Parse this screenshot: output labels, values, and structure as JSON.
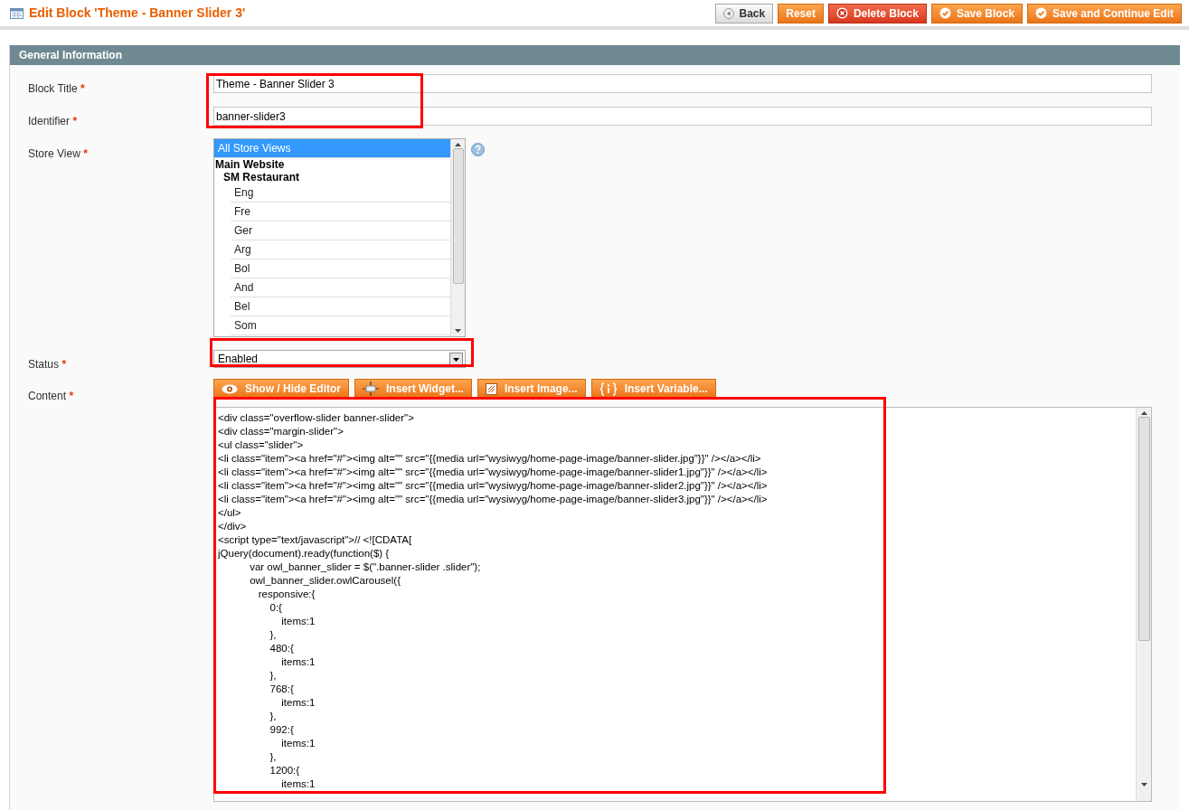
{
  "page_title": "Edit Block 'Theme - Banner Slider 3'",
  "actions": [
    {
      "kind": "back",
      "label": "Back"
    },
    {
      "kind": "plain",
      "label": "Reset"
    },
    {
      "kind": "delete",
      "label": "Delete Block"
    },
    {
      "kind": "save",
      "label": "Save Block"
    },
    {
      "kind": "save",
      "label": "Save and Continue Edit"
    }
  ],
  "section": {
    "title": "General Information"
  },
  "fields": {
    "block_title": {
      "label": "Block Title",
      "required_mark": "*",
      "value": "Theme - Banner Slider 3"
    },
    "identifier": {
      "label": "Identifier",
      "required_mark": "*",
      "value": "banner-slider3"
    },
    "store_view": {
      "label": "Store View",
      "required_mark": "*",
      "options": [
        {
          "kind": "option",
          "label": "All Store Views",
          "selected": true
        },
        {
          "kind": "group",
          "label": "Main Website",
          "children": [
            {
              "kind": "group",
              "label": "SM Restaurant",
              "children": [
                {
                  "kind": "option",
                  "label": "Eng",
                  "selected": false
                },
                {
                  "kind": "option",
                  "label": "Fre",
                  "selected": false
                },
                {
                  "kind": "option",
                  "label": "Ger",
                  "selected": false
                },
                {
                  "kind": "option",
                  "label": "Arg",
                  "selected": false
                },
                {
                  "kind": "option",
                  "label": "Bol",
                  "selected": false
                },
                {
                  "kind": "option",
                  "label": "And",
                  "selected": false
                },
                {
                  "kind": "option",
                  "label": "Bel",
                  "selected": false
                },
                {
                  "kind": "option",
                  "label": "Som",
                  "selected": false
                }
              ]
            }
          ]
        }
      ]
    },
    "status": {
      "label": "Status",
      "required_mark": "*",
      "value": "Enabled"
    },
    "content": {
      "label": "Content",
      "required_mark": "*",
      "editor_buttons": [
        {
          "kind": "eye",
          "label": "Show / Hide Editor"
        },
        {
          "kind": "widget",
          "label": "Insert Widget..."
        },
        {
          "kind": "image",
          "label": "Insert Image..."
        },
        {
          "kind": "variable",
          "label": "Insert Variable..."
        }
      ],
      "lines": [
        "<div class=\"overflow-slider banner-slider\">",
        "<div class=\"margin-slider\">",
        "<ul class=\"slider\">",
        "<li class=\"item\"><a href=\"#\"><img alt=\"\" src=\"{{media url=\"wysiwyg/home-page-image/banner-slider.jpg\"}}\" /></a></li>",
        "<li class=\"item\"><a href=\"#\"><img alt=\"\" src=\"{{media url=\"wysiwyg/home-page-image/banner-slider1.jpg\"}}\" /></a></li>",
        "<li class=\"item\"><a href=\"#\"><img alt=\"\" src=\"{{media url=\"wysiwyg/home-page-image/banner-slider2.jpg\"}}\" /></a></li>",
        "<li class=\"item\"><a href=\"#\"><img alt=\"\" src=\"{{media url=\"wysiwyg/home-page-image/banner-slider3.jpg\"}}\" /></a></li>",
        "</ul>",
        "</div>",
        "<script type=\"text/javascript\">// <![CDATA[",
        "jQuery(document).ready(function($) {",
        "           var owl_banner_slider = $(\".banner-slider .slider\");",
        "           owl_banner_slider.owlCarousel({",
        "              responsive:{",
        "                  0:{",
        "                      items:1",
        "                  },",
        "                  480:{",
        "                      items:1",
        "                  },",
        "                  768:{",
        "                      items:1",
        "                  },",
        "                  992:{",
        "                      items:1",
        "                  },",
        "                  1200:{",
        "                      items:1"
      ]
    }
  }
}
